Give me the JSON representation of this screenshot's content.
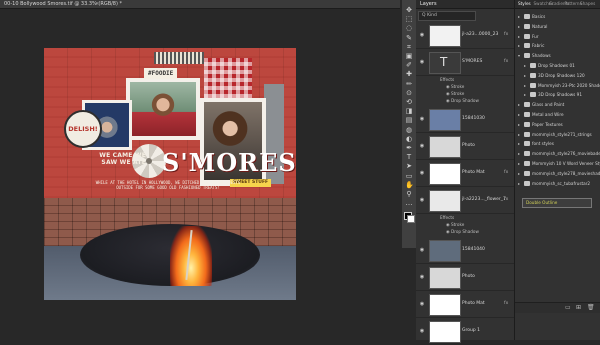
{
  "document": {
    "tab_label": "00-10 Bollywood Smores.tif @ 33.3% (RGB/8) *",
    "close_glyph": "×"
  },
  "scrapbook": {
    "foodie_tag": "#FOODIE",
    "delish_badge": "DELISH!",
    "we_came_text": "WE CAME WE SAW WE ATE",
    "title": "S'MORES",
    "sweet_stuff_tag": "SWEET STUFF",
    "journaling": "WHILE AT THE HOTEL IN HOLLYWOOD, WE DITCHED THE OTHER GUESTS OUTSIDE FOR SOME GOOD OLD FASHIONED TREATS!"
  },
  "toolbar": {
    "tools": [
      "move-icon",
      "marquee-icon",
      "lasso-icon",
      "quick-select-icon",
      "crop-icon",
      "frame-icon",
      "eyedropper-icon",
      "healing-icon",
      "brush-icon",
      "stamp-icon",
      "history-brush-icon",
      "eraser-icon",
      "gradient-icon",
      "blur-icon",
      "dodge-icon",
      "pen-icon",
      "type-icon",
      "path-select-icon",
      "rectangle-icon",
      "hand-icon",
      "zoom-icon",
      "more-icon"
    ],
    "glyphs": [
      "✥",
      "⬚",
      "◌",
      "✎",
      "⌗",
      "▣",
      "✐",
      "✚",
      "✏",
      "⊙",
      "⟲",
      "◨",
      "▤",
      "◍",
      "◐",
      "✒",
      "T",
      "➤",
      "▭",
      "✋",
      "⚲",
      "…"
    ]
  },
  "layers_panel": {
    "tab": "Layers",
    "filter": "Q Kind",
    "rows": [
      {
        "name": "jl-a23...0000_23",
        "thumb": "#f2f2f2",
        "fx": true
      },
      {
        "name": "S'MORES",
        "thumb": "#3a3a3a",
        "fx": true,
        "type_layer": true
      },
      {
        "name": "15841030",
        "thumb": "#6a7fa6",
        "fx": false
      },
      {
        "name": "Photo",
        "thumb": "#d8d8d8",
        "fx": false
      },
      {
        "name": "Photo Mat",
        "thumb": "#ffffff",
        "fx": true
      },
      {
        "name": "jl-a2223..._flower_7",
        "thumb": "#e9e9e9",
        "fx": true
      },
      {
        "name": "15841040",
        "thumb": "#5f6c7c",
        "fx": false
      },
      {
        "name": "Photo",
        "thumb": "#d8d8d8",
        "fx": false
      },
      {
        "name": "Photo Mat",
        "thumb": "#ffffff",
        "fx": true
      },
      {
        "name": "Group 1",
        "thumb": "#ffffff",
        "fx": false,
        "group": true
      }
    ],
    "effects_a": {
      "title": "Effects",
      "items": [
        "Stroke",
        "Stroke",
        "Drop Shadow"
      ]
    },
    "effects_b": {
      "title": "Effects",
      "items": [
        "Stroke",
        "Drop Shadow"
      ]
    }
  },
  "styles_panel": {
    "tabs": [
      "Styles",
      "Swatches",
      "Gradients",
      "Patterns",
      "Shapes"
    ],
    "items": [
      {
        "label": "Basics",
        "level": 0,
        "expanded": false
      },
      {
        "label": "Natural",
        "level": 0,
        "expanded": false
      },
      {
        "label": "Fur",
        "level": 0,
        "expanded": false
      },
      {
        "label": "Fabric",
        "level": 0,
        "expanded": false
      },
      {
        "label": "Shadows",
        "level": 0,
        "expanded": true
      },
      {
        "label": "Drop Shadows 01",
        "level": 1,
        "expanded": false
      },
      {
        "label": "3D Drop Shadows 120",
        "level": 1,
        "expanded": false
      },
      {
        "label": "Mommyish 23-Ptc 2020 Shadow",
        "level": 1,
        "expanded": false
      },
      {
        "label": "3D Drop Shadows 91",
        "level": 1,
        "expanded": false
      },
      {
        "label": "Glass and Paint",
        "level": 0,
        "expanded": false
      },
      {
        "label": "Metal and Wire",
        "level": 0,
        "expanded": false
      },
      {
        "label": "Paper Textures",
        "level": 0,
        "expanded": false
      },
      {
        "label": "mommyish_style271_strings",
        "level": 0,
        "expanded": false
      },
      {
        "label": "font styles",
        "level": 0,
        "expanded": false
      },
      {
        "label": "mommyish_style276_moviebadee",
        "level": 0,
        "expanded": false
      },
      {
        "label": "Mommyish 10 V Word Veneer Styles",
        "level": 0,
        "expanded": false
      },
      {
        "label": "mommyish_style278_movieshadow",
        "level": 0,
        "expanded": false
      },
      {
        "label": "mommyish_sc_tubafrustar2",
        "level": 0,
        "expanded": false
      }
    ],
    "selected_style": "Double Outline",
    "footer_icons": [
      "folder-icon",
      "new-style-icon",
      "trash-icon"
    ],
    "footer_glyphs": [
      "▭",
      "⊞",
      "🗑"
    ]
  },
  "colors": {
    "background": "#282828",
    "panel": "#323232",
    "wood_red": "#c44a40",
    "title_white": "#ffffff",
    "sweet_yellow": "#f6d44c"
  }
}
